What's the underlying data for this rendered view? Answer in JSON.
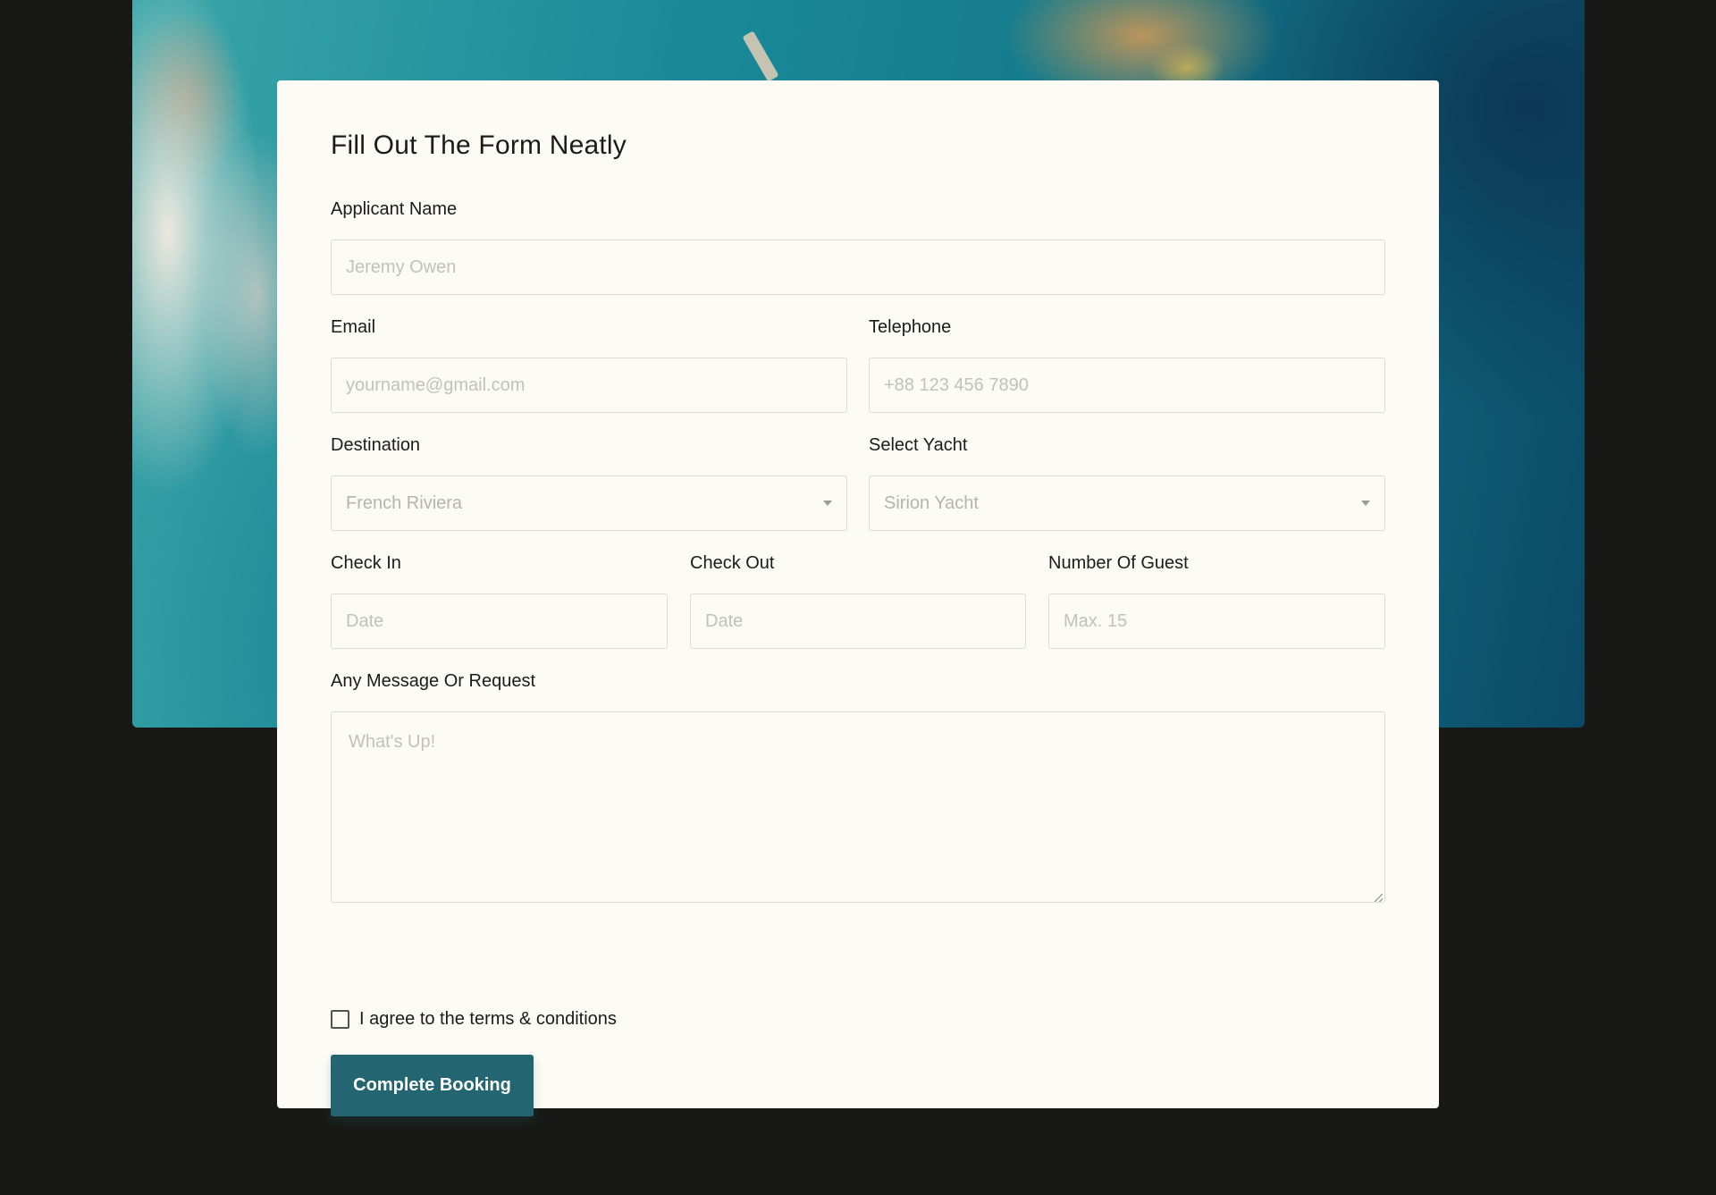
{
  "colors": {
    "page_background": "#181916",
    "card_background": "#fcfbf6",
    "button_background": "#236672",
    "text": "#1b1c19",
    "placeholder": "#c2c1bb"
  },
  "hero": {
    "image": "aerial ocean coastline photo"
  },
  "form": {
    "title": "Fill Out The Form Neatly",
    "applicant_name": {
      "label": "Applicant Name",
      "placeholder": "Jeremy Owen"
    },
    "email": {
      "label": "Email",
      "placeholder": "yourname@gmail.com"
    },
    "telephone": {
      "label": "Telephone",
      "placeholder": "+88 123 456 7890"
    },
    "destination": {
      "label": "Destination",
      "selected": "French Riviera",
      "icon": "chevron-down-icon"
    },
    "yacht": {
      "label": "Select Yacht",
      "selected": "Sirion Yacht",
      "icon": "chevron-down-icon"
    },
    "check_in": {
      "label": "Check In",
      "placeholder": "Date"
    },
    "check_out": {
      "label": "Check Out",
      "placeholder": "Date"
    },
    "guests": {
      "label": "Number Of Guest",
      "placeholder": "Max. 15"
    },
    "message": {
      "label": "Any Message Or Request",
      "placeholder": "What's Up!"
    },
    "terms": {
      "label": "I agree to the terms & conditions",
      "checked": false
    },
    "submit_label": "Complete Booking"
  }
}
